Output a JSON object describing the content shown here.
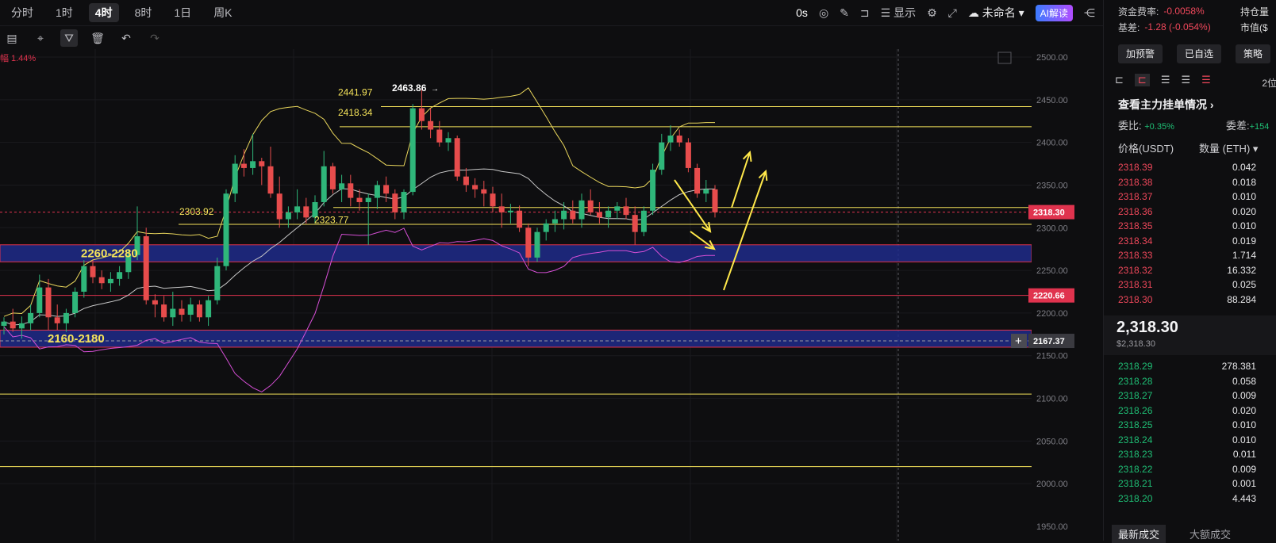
{
  "timeframes": [
    "分时",
    "1时",
    "4时",
    "8时",
    "1日",
    "周K"
  ],
  "active_timeframe": "4时",
  "topbar": {
    "seconds": "0s",
    "display_label": "显示",
    "layout_name": "未命名",
    "ai_label": "AI解读"
  },
  "chart_labels": {
    "change_prefix": "幅",
    "change_value": "1.44%",
    "zone_upper": "2260-2280",
    "zone_lower": "2160-2180",
    "high_label": "2463.86",
    "level_2441": "2441.97",
    "level_2418": "2418.34",
    "level_2323": "2323.77",
    "level_2303": "2303.92"
  },
  "axis_ticks": [
    "2500.00",
    "2450.00",
    "2400.00",
    "2350.00",
    "2300.00",
    "2250.00",
    "2200.00",
    "2150.00",
    "2100.00",
    "2050.00",
    "2000.00",
    "1950.00"
  ],
  "price_tags": {
    "current": "2318.30",
    "line_2220": "2220.66",
    "cursor": "2167.37"
  },
  "colors": {
    "up": "#1fbf75",
    "down": "#f0485b",
    "candle_down": "#e74c4c",
    "candle_up": "#2fb67a",
    "level_yellow": "#f5e35a",
    "zone_blue": "#1f2a8a",
    "bb_upper": "#e9d65c",
    "bb_mid": "#c9c9c9",
    "bb_lower": "#d64fd6",
    "arrow": "#ffe84a"
  },
  "panel": {
    "funding_label": "资金费率:",
    "funding_value": "-0.0058%",
    "open_interest_label": "持仓量",
    "basis_label": "基差:",
    "basis_value": "-1.28 (-0.054%)",
    "market_value_label": "市值($",
    "btn_alert": "加预警",
    "btn_watch": "已自选",
    "btn_strategy": "策略",
    "decimals": "2位",
    "view_orders": "查看主力挂单情况",
    "ratio_label": "委比:",
    "ratio_value": "+0.35%",
    "diff_label": "委差:",
    "diff_value": "+154",
    "col_price": "价格(USDT)",
    "col_qty": "数量 (ETH)",
    "last_price": "2,318.30",
    "last_price_usd": "$2,318.30",
    "tab_latest": "最新成交",
    "tab_large": "大额成交"
  },
  "asks": [
    {
      "price": "2318.39",
      "qty": "0.042"
    },
    {
      "price": "2318.38",
      "qty": "0.018"
    },
    {
      "price": "2318.37",
      "qty": "0.010"
    },
    {
      "price": "2318.36",
      "qty": "0.020"
    },
    {
      "price": "2318.35",
      "qty": "0.010"
    },
    {
      "price": "2318.34",
      "qty": "0.019"
    },
    {
      "price": "2318.33",
      "qty": "1.714"
    },
    {
      "price": "2318.32",
      "qty": "16.332"
    },
    {
      "price": "2318.31",
      "qty": "0.025"
    },
    {
      "price": "2318.30",
      "qty": "88.284"
    }
  ],
  "bids": [
    {
      "price": "2318.29",
      "qty": "278.381"
    },
    {
      "price": "2318.28",
      "qty": "0.058"
    },
    {
      "price": "2318.27",
      "qty": "0.009"
    },
    {
      "price": "2318.26",
      "qty": "0.020"
    },
    {
      "price": "2318.25",
      "qty": "0.010"
    },
    {
      "price": "2318.24",
      "qty": "0.010"
    },
    {
      "price": "2318.23",
      "qty": "0.011"
    },
    {
      "price": "2318.22",
      "qty": "0.009"
    },
    {
      "price": "2318.21",
      "qty": "0.001"
    },
    {
      "price": "2318.20",
      "qty": "4.443"
    }
  ],
  "chart_data": {
    "type": "candlestick",
    "title": "",
    "y_axis_range": [
      1950,
      2500
    ],
    "grid": true,
    "horizontal_levels": [
      2441.97,
      2418.34,
      2323.77,
      2303.92,
      2220.66,
      2105,
      2020
    ],
    "zones": [
      {
        "label": "2260-2280",
        "low": 2260,
        "high": 2280
      },
      {
        "label": "2160-2180",
        "low": 2160,
        "high": 2180
      }
    ],
    "current_price": 2318.3,
    "candles": [
      [
        2185,
        2195,
        2175,
        2190
      ],
      [
        2190,
        2205,
        2178,
        2182
      ],
      [
        2182,
        2196,
        2170,
        2188
      ],
      [
        2188,
        2210,
        2180,
        2200
      ],
      [
        2200,
        2245,
        2195,
        2230
      ],
      [
        2230,
        2240,
        2180,
        2195
      ],
      [
        2195,
        2210,
        2180,
        2188
      ],
      [
        2188,
        2205,
        2178,
        2200
      ],
      [
        2200,
        2230,
        2195,
        2225
      ],
      [
        2225,
        2262,
        2218,
        2255
      ],
      [
        2255,
        2262,
        2235,
        2242
      ],
      [
        2242,
        2250,
        2228,
        2235
      ],
      [
        2235,
        2248,
        2225,
        2240
      ],
      [
        2240,
        2255,
        2232,
        2248
      ],
      [
        2248,
        2275,
        2240,
        2268
      ],
      [
        2268,
        2325,
        2262,
        2290
      ],
      [
        2290,
        2300,
        2210,
        2215
      ],
      [
        2215,
        2222,
        2195,
        2210
      ],
      [
        2210,
        2220,
        2190,
        2195
      ],
      [
        2195,
        2225,
        2185,
        2205
      ],
      [
        2205,
        2215,
        2190,
        2198
      ],
      [
        2198,
        2218,
        2190,
        2210
      ],
      [
        2210,
        2215,
        2190,
        2195
      ],
      [
        2195,
        2220,
        2185,
        2215
      ],
      [
        2215,
        2265,
        2210,
        2255
      ],
      [
        2255,
        2345,
        2250,
        2340
      ],
      [
        2340,
        2385,
        2330,
        2375
      ],
      [
        2375,
        2392,
        2360,
        2370
      ],
      [
        2370,
        2410,
        2362,
        2378
      ],
      [
        2378,
        2382,
        2350,
        2372
      ],
      [
        2372,
        2395,
        2335,
        2340
      ],
      [
        2340,
        2360,
        2300,
        2310
      ],
      [
        2310,
        2325,
        2300,
        2318
      ],
      [
        2318,
        2345,
        2310,
        2325
      ],
      [
        2325,
        2335,
        2305,
        2312
      ],
      [
        2312,
        2338,
        2305,
        2330
      ],
      [
        2330,
        2390,
        2325,
        2372
      ],
      [
        2372,
        2376,
        2340,
        2345
      ],
      [
        2345,
        2362,
        2330,
        2352
      ],
      [
        2352,
        2362,
        2325,
        2335
      ],
      [
        2335,
        2345,
        2320,
        2330
      ],
      [
        2330,
        2340,
        2280,
        2335
      ],
      [
        2335,
        2355,
        2322,
        2350
      ],
      [
        2350,
        2360,
        2330,
        2340
      ],
      [
        2340,
        2345,
        2310,
        2318
      ],
      [
        2318,
        2345,
        2310,
        2342
      ],
      [
        2342,
        2445,
        2338,
        2440
      ],
      [
        2440,
        2462,
        2415,
        2425
      ],
      [
        2425,
        2440,
        2405,
        2415
      ],
      [
        2415,
        2425,
        2395,
        2400
      ],
      [
        2400,
        2412,
        2390,
        2405
      ],
      [
        2405,
        2408,
        2355,
        2360
      ],
      [
        2360,
        2370,
        2342,
        2350
      ],
      [
        2350,
        2358,
        2335,
        2345
      ],
      [
        2345,
        2355,
        2325,
        2340
      ],
      [
        2340,
        2348,
        2318,
        2325
      ],
      [
        2325,
        2340,
        2300,
        2318
      ],
      [
        2318,
        2328,
        2305,
        2320
      ],
      [
        2320,
        2326,
        2295,
        2300
      ],
      [
        2300,
        2305,
        2255,
        2265
      ],
      [
        2265,
        2300,
        2260,
        2295
      ],
      [
        2295,
        2310,
        2285,
        2305
      ],
      [
        2305,
        2320,
        2295,
        2310
      ],
      [
        2310,
        2330,
        2298,
        2320
      ],
      [
        2320,
        2332,
        2305,
        2310
      ],
      [
        2310,
        2340,
        2300,
        2332
      ],
      [
        2332,
        2345,
        2315,
        2318
      ],
      [
        2318,
        2330,
        2305,
        2312
      ],
      [
        2312,
        2325,
        2300,
        2320
      ],
      [
        2320,
        2330,
        2310,
        2325
      ],
      [
        2325,
        2335,
        2310,
        2315
      ],
      [
        2315,
        2325,
        2280,
        2295
      ],
      [
        2295,
        2325,
        2290,
        2320
      ],
      [
        2320,
        2375,
        2315,
        2368
      ],
      [
        2368,
        2410,
        2362,
        2400
      ],
      [
        2400,
        2420,
        2390,
        2408
      ],
      [
        2408,
        2415,
        2395,
        2400
      ],
      [
        2400,
        2405,
        2365,
        2370
      ],
      [
        2370,
        2375,
        2335,
        2340
      ],
      [
        2340,
        2356,
        2330,
        2345
      ],
      [
        2345,
        2350,
        2312,
        2318
      ]
    ]
  }
}
